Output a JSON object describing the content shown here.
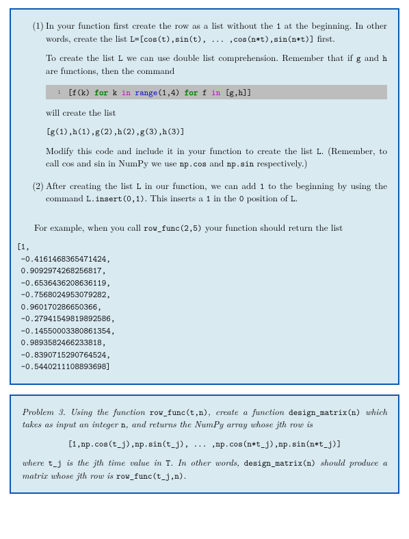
{
  "item1": {
    "num": "(1)",
    "p1_a": "In your function first create the row as a list without the ",
    "p1_code1": "1",
    "p1_b": " at the beginning. In other words, create the list ",
    "p1_code2": "L=[cos(t),sin(t), ... ,cos(n*t),sin(n*t)]",
    "p1_c": " first.",
    "p2_a": "To create the list ",
    "p2_code1": "L",
    "p2_b": " we can use double list comprehension. Remember that if ",
    "p2_code2": "g",
    "p2_c": " and ",
    "p2_code3": "h",
    "p2_d": " are functions, then the command",
    "code_lineno": "1",
    "code_seg1": "[f(k) ",
    "code_for1": "for",
    "code_seg2": " k ",
    "code_in1": "in",
    "code_seg3": " ",
    "code_range": "range",
    "code_seg4": "(1,4) ",
    "code_for2": "for",
    "code_seg5": " f ",
    "code_in2": "in",
    "code_seg6": " [g,h]]",
    "p3": "will create the list",
    "p4_code": "[g(1),h(1),g(2),h(2),g(3),h(3)]",
    "p5_a": "Modify this code and include it in your function to create the list ",
    "p5_code1": "L",
    "p5_b": ". (Remember, to call cos and sin in NumPy we use ",
    "p5_code2": "np.cos",
    "p5_c": " and ",
    "p5_code3": "np.sin",
    "p5_d": " respectively.)"
  },
  "item2": {
    "num": "(2)",
    "p1_a": "After creating the list ",
    "p1_code1": "L",
    "p1_b": " in our function, we can add ",
    "p1_code2": "1",
    "p1_c": " to the beginning by using the command ",
    "p1_code3": "L.insert(0,1)",
    "p1_d": ". This inserts a ",
    "p1_code4": "1",
    "p1_e": " in the ",
    "p1_code5": "0",
    "p1_f": " position of ",
    "p1_code6": "L",
    "p1_g": "."
  },
  "forexample": {
    "a": "For example, when you call ",
    "code": "row_func(2,5)",
    "b": " your function should return the list"
  },
  "output": "[1,\n -0.4161468365471424,\n 0.9092974268256817,\n -0.6536436208636119,\n -0.7568024953079282,\n 0.960170286650366,\n -0.27941549819892586,\n -0.14550003380861354,\n 0.9893582466233818,\n -0.8390715290764524,\n -0.5440211108893698]",
  "problem3": {
    "lead_a": "Problem 3.",
    "lead_b": " Using the function ",
    "code1": "row_func(t,n)",
    "lead_c": ", create a function ",
    "code2": "design_matrix(n)",
    "lead_d": " which takes as input an integer ",
    "code3": "n",
    "lead_e": ", and returns the NumPy array whose ",
    "jth": "j",
    "lead_f": "th row is",
    "centercode": "[1,np.cos(t_j),np.sin(t_j), ... ,np.cos(n*t_j),np.sin(n*t_j)]",
    "tail_a": "where ",
    "code4": "t_j",
    "tail_b": " is the ",
    "tail_c": "th time value in ",
    "code5": "T",
    "tail_d": ". In other words, ",
    "code6": "design_matrix(n)",
    "tail_e": " should produce a matrix whose ",
    "tail_f": "th row is ",
    "code7": "row_func(t_j,n)",
    "tail_g": "."
  }
}
